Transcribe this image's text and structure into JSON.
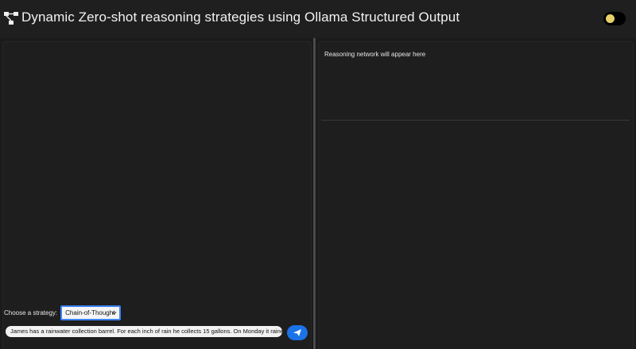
{
  "header": {
    "title": "Dynamic Zero-shot reasoning strategies using Ollama Structured Output",
    "logo_icon": "network-icon",
    "theme_toggle_icon": "theme-toggle-icon"
  },
  "left_panel": {
    "strategy_label": "Choose a strategy:",
    "strategy_selected": "Chain-of-Thought",
    "query_value": "James has a rainwater collection barrel. For each inch of rain he collects 15 gallons. On Monday it raine",
    "send_icon": "send-icon"
  },
  "right_panel": {
    "placeholder": "Reasoning network will appear here"
  },
  "colors": {
    "accent": "#1b73e8",
    "select_border": "#3b82f6",
    "toggle_knob": "#e8d16a",
    "background": "#1b1b1b"
  }
}
